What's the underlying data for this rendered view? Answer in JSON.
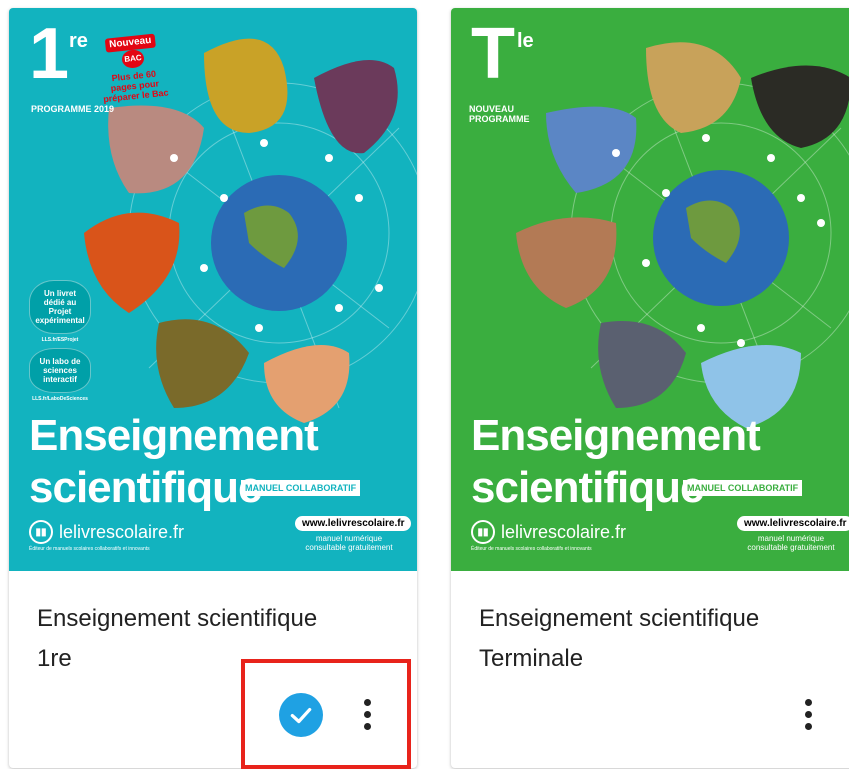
{
  "cards": [
    {
      "cover": {
        "level": "1",
        "level_sup": "re",
        "program": "PROGRAMME 2019",
        "nouveau": "Nouveau",
        "bac": "BAC",
        "promo": "Plus de 60 pages pour préparer le Bac",
        "bubble1": "Un livret dédié au Projet expérimental",
        "bubble1_link": "LLS.fr/ESProjet",
        "bubble2": "Un labo de sciences interactif",
        "bubble2_link": "LLS.fr/LaboDeSciences",
        "title_line1": "Enseignement",
        "title_line2": "scientifique",
        "badge": "MANUEL COLLABORATIF",
        "logo": "lelivrescolaire.fr",
        "logo_sub": "Éditeur de manuels scolaires collaboratifs et innovants",
        "www": "www.lelivrescolaire.fr",
        "www_sub": "manuel numérique consultable gratuitement",
        "color": "#12b3bf"
      },
      "name_line1": "Enseignement scientifique",
      "name_line2": "1re",
      "selected": true
    },
    {
      "cover": {
        "level": "T",
        "level_sup": "le",
        "program": "NOUVEAU PROGRAMME",
        "title_line1": "Enseignement",
        "title_line2": "scientifique",
        "badge": "MANUEL COLLABORATIF",
        "logo": "lelivrescolaire.fr",
        "logo_sub": "Éditeur de manuels scolaires collaboratifs et innovants",
        "www": "www.lelivrescolaire.fr",
        "www_sub": "manuel numérique consultable gratuitement",
        "color": "#3aae3f"
      },
      "name_line1": "Enseignement scientifique",
      "name_line2": "Terminale",
      "selected": false
    }
  ],
  "icons": {
    "check": "check-circle-icon",
    "more": "more-vertical-icon"
  },
  "colors": {
    "accent": "#1fa1e3",
    "highlight": "#e8231b"
  }
}
